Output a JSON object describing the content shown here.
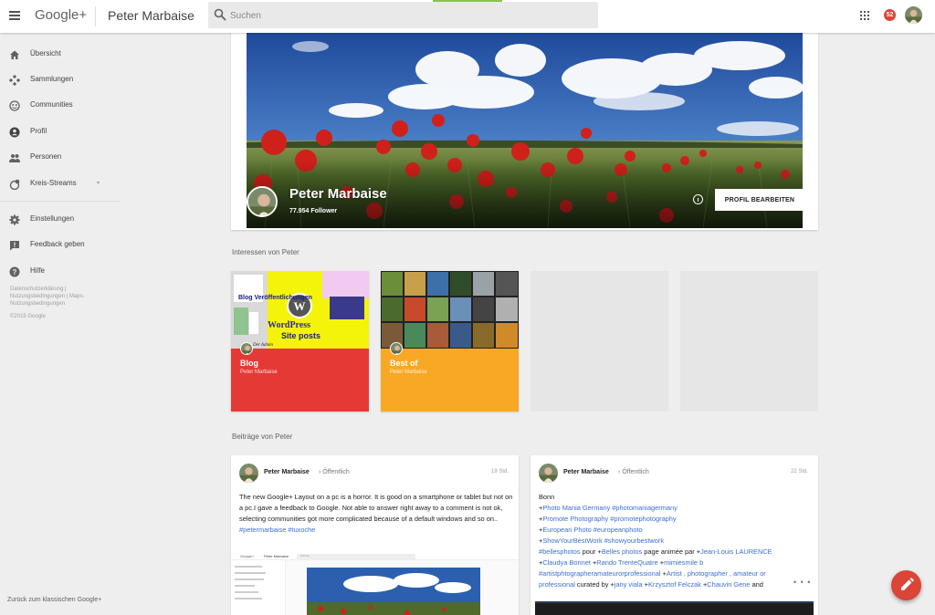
{
  "topbar": {
    "logo": "Google+",
    "page_title": "Peter Marbaise",
    "search_placeholder": "Suchen",
    "notification_count": "52",
    "icons": [
      "menu-icon",
      "search-icon",
      "apps-icon",
      "avatar"
    ]
  },
  "sidebar": {
    "items": [
      {
        "label": "Übersicht",
        "icon": "home-icon"
      },
      {
        "label": "Sammlungen",
        "icon": "collections-icon"
      },
      {
        "label": "Communities",
        "icon": "communities-icon"
      },
      {
        "label": "Profil",
        "icon": "profile-icon"
      },
      {
        "label": "Personen",
        "icon": "people-icon"
      },
      {
        "label": "Kreis-Streams",
        "icon": "circles-icon"
      },
      {
        "label": "Einstellungen",
        "icon": "settings-icon"
      },
      {
        "label": "Feedback geben",
        "icon": "feedback-icon"
      },
      {
        "label": "Hilfe",
        "icon": "help-icon"
      }
    ],
    "legal_line1": "Datenschutzerklärung |",
    "legal_line2": "Nutzungsbedingungen | Maps-",
    "legal_line3": "Nutzungsbedingungen",
    "copyright": "©2015 Google",
    "back_classic": "Zurück zum klassischen Google+"
  },
  "profile": {
    "name": "Peter Marbaise",
    "followers": "77.954 Follower",
    "edit_button": "PROFIL BEARBEITEN"
  },
  "interests": {
    "title": "Interessen von Peter",
    "collections": [
      {
        "title": "Blog",
        "owner": "Peter Marbaise",
        "color": "#e53935",
        "thumb_text_1": "Blog Veröffentlichungen",
        "thumb_text_2": "WordPress",
        "thumb_text_3": "Site posts",
        "thumb_text_4": "Der Admin"
      },
      {
        "title": "Best of",
        "owner": "Peter Marbaise",
        "color": "#f9a825"
      }
    ]
  },
  "posts_section": {
    "title": "Beiträge von Peter",
    "posts": [
      {
        "author": "Peter Marbaise",
        "visibility": "Öffentlich",
        "time": "19 Std.",
        "text": "The new Google+ Layout on a pc is a horror. It is good on a smartphone or tablet but not on a pc.I gave a feedback to Google. Not able to answer right away to a comment is not ok, selecting communities got more complicated because of a default windows and so on..",
        "hashtags": "#petermarbaise #tuxoche",
        "mini_logo": "Google+",
        "mini_name": "Peter Marbaise",
        "mini_search": "Suchen"
      },
      {
        "author": "Peter Marbaise",
        "visibility": "Öffentlich",
        "time": "22 Std.",
        "line1": "Bonn",
        "line2a": "+",
        "line2b": "Photo Mania Germany #photomaniagermany",
        "line3a": "+",
        "line3b": "Promote Photography #promotephotography",
        "line4a": "+",
        "line4b": "European Photo #europeanphoto",
        "line5a": "+",
        "line5b": "ShowYourBestWork #showyourbestwork",
        "line6a": "#bellesphotos",
        "line6b": " pour +",
        "line6c": "Belles photos",
        "line6d": " page animée par +",
        "line6e": "Jean-Louis LAURENCE",
        "line7a": "+",
        "line7b": "Claudya Bonnet",
        "line7c": " +",
        "line7d": "Rando TrenteQuatre",
        "line7e": " +",
        "line7f": "mimiesmile b",
        "line8a": "#artistphtographeramateurorprofessional",
        "line8b": " +",
        "line8c": "Artist , photographer , amateur or",
        "line9a": "professional",
        "line9b": " curated by +",
        "line9c": "jany viala",
        "line9d": " +",
        "line9e": "Krzysztof Felczak",
        "line9f": " +",
        "line9g": "Chauvin Gene",
        "line9h": " and",
        "more": "• • •"
      }
    ]
  },
  "colors": {
    "accent_red": "#db4437",
    "link_blue": "#3b6fd4",
    "blog_band": "#e53935",
    "bestof_band": "#f9a825"
  }
}
